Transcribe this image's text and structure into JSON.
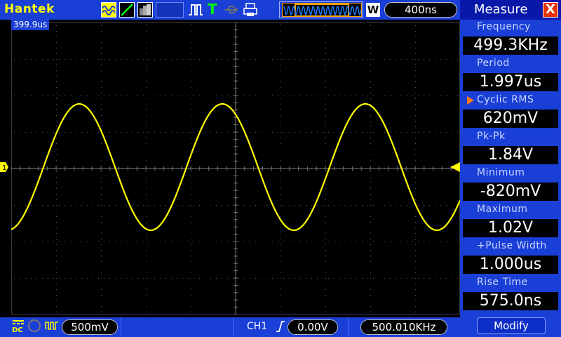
{
  "header": {
    "brand": "Hantek",
    "timebase": "400ns",
    "window_mode_badge": "W",
    "icons": [
      "wave-icon",
      "ramp-icon",
      "persist-icon",
      "pulse-icon",
      "trigger-icon",
      "usb-icon",
      "printer-icon"
    ]
  },
  "screen": {
    "cursor_readout": "399.9us",
    "channel_marker": "1",
    "trace_color": "#ffff00"
  },
  "measure_panel": {
    "title": "Measure",
    "close_glyph": "X",
    "items": [
      {
        "label": "Frequency",
        "value": "499.3KHz"
      },
      {
        "label": "Period",
        "value": "1.997us"
      },
      {
        "label": "Cyclic RMS",
        "value": "620mV",
        "selected": true
      },
      {
        "label": "Pk-Pk",
        "value": "1.84V"
      },
      {
        "label": "Minimum",
        "value": "-820mV"
      },
      {
        "label": "Maximum",
        "value": "1.02V"
      },
      {
        "label": "+Pulse Width",
        "value": "1.000us"
      },
      {
        "label": "Rise Time",
        "value": "575.0ns"
      }
    ],
    "modify_label": "Modify"
  },
  "footer": {
    "coupling": "DC",
    "vertical_scale": "500mV",
    "trigger_source": "CH1",
    "trigger_level": "0.00V",
    "trigger_frequency": "500.010KHz"
  },
  "colors": {
    "bar_blue": "#1a3fd6",
    "panel_header": "#0818a8",
    "accent_yellow": "#ffff00",
    "close_red": "#e83000"
  }
}
